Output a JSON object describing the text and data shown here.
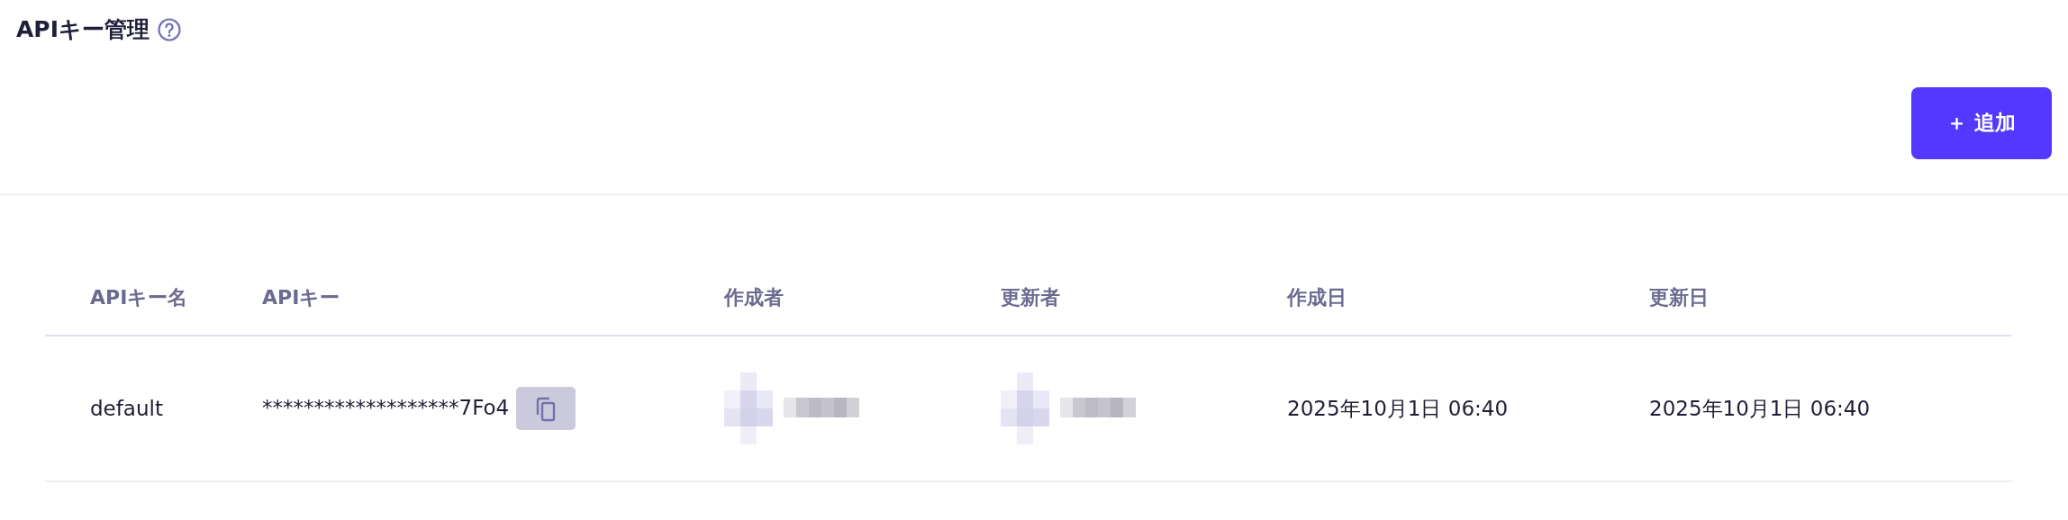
{
  "page": {
    "title": "APIキー管理"
  },
  "add_button": {
    "label": "＋ 追加"
  },
  "table": {
    "columns": [
      "APIキー名",
      "APIキー",
      "作成者",
      "更新者",
      "作成日",
      "更新日"
    ],
    "rows": [
      {
        "name": "default",
        "key": "*******************7Fo4",
        "created_at": "2025年10月1日 06:40",
        "updated_at": "2025年10月1日 06:40"
      }
    ]
  }
}
